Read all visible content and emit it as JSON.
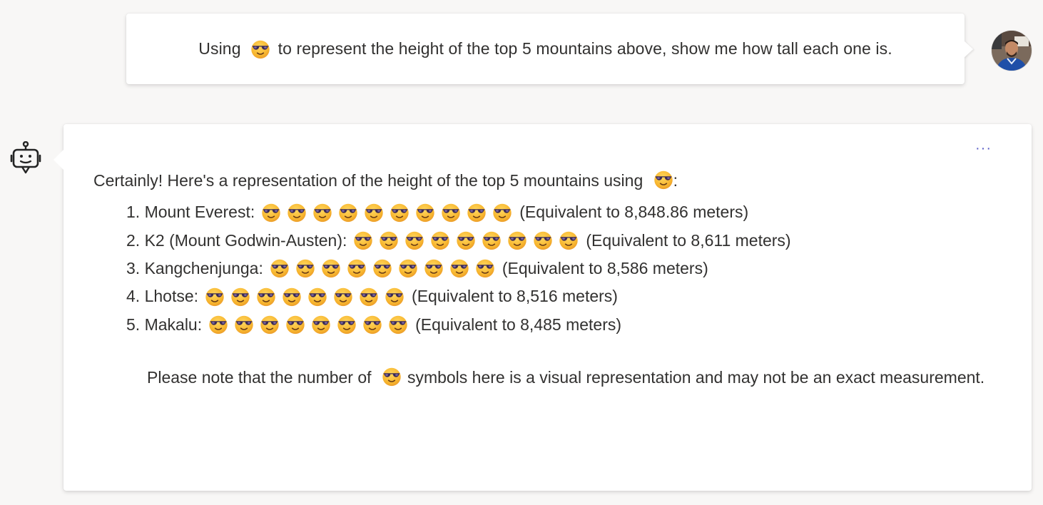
{
  "user_message": {
    "text_before": "Using",
    "emoji": "smiling-face-with-sunglasses",
    "text_after": "to represent the height of the top 5 mountains above, show me how tall each one is."
  },
  "bot_message": {
    "more_label": "···",
    "intro_before": "Certainly! Here's a representation of the height of the top 5 mountains using",
    "intro_after": ":",
    "mountains": [
      {
        "label": "1. Mount Everest:",
        "emoji_count": 10,
        "note": "(Equivalent to 8,848.86 meters)"
      },
      {
        "label": "2. K2 (Mount Godwin-Austen):",
        "emoji_count": 9,
        "note": "(Equivalent to 8,611 meters)"
      },
      {
        "label": "3. Kangchenjunga:",
        "emoji_count": 9,
        "note": "(Equivalent to 8,586 meters)"
      },
      {
        "label": "4. Lhotse:",
        "emoji_count": 8,
        "note": "(Equivalent to 8,516 meters)"
      },
      {
        "label": "5. Makalu:",
        "emoji_count": 8,
        "note": "(Equivalent to 8,485 meters)"
      }
    ],
    "note_before": "Please note that the number of",
    "note_after": "symbols here is a visual representation and may not be an exact measurement."
  },
  "colors": {
    "background": "#f8f7f6",
    "bubble": "#ffffff",
    "text": "#323130",
    "accent": "#5b5fc7",
    "emoji_face": "#f7b52e",
    "emoji_glasses": "#3a2a55"
  },
  "icons": {
    "bot": "bot-icon",
    "avatar": "user-avatar"
  }
}
